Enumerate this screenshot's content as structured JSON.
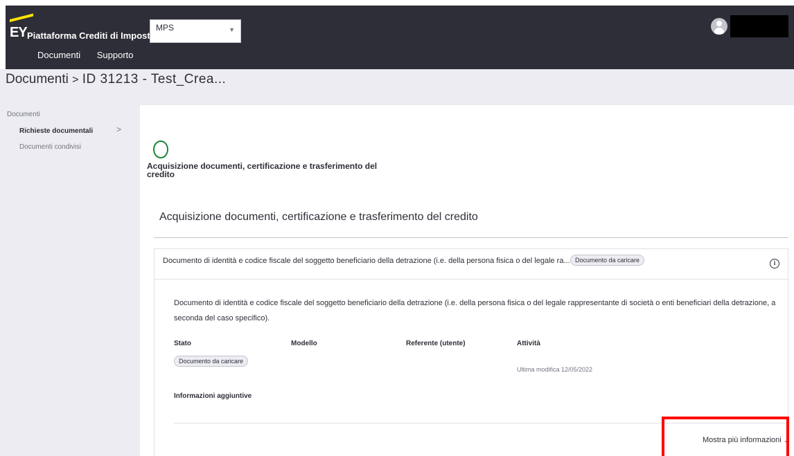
{
  "header": {
    "logo_text": "EY",
    "app_title": "Piattaforma Crediti di Imposta",
    "client_select_value": "MPS",
    "nav": [
      "Documenti",
      "Supporto"
    ]
  },
  "breadcrumb": {
    "root": "Documenti",
    "separator": ">",
    "current": "ID 31213 - Test_Crea..."
  },
  "sidebar": {
    "title": "Documenti",
    "items": [
      {
        "label": "Richieste documentali",
        "active": true
      },
      {
        "label": "Documenti condivisi",
        "active": false
      }
    ]
  },
  "step": {
    "title": "Acquisizione documenti, certificazione e trasferimento del credito"
  },
  "section": {
    "title": "Acquisizione documenti, certificazione e trasferimento del credito"
  },
  "card": {
    "header_title": "Documento di identità e codice fiscale del soggetto beneficiario della detrazione (i.e. della persona fisica o del legale ra...",
    "header_badge": "Documento da caricare",
    "description": "Documento di identità e codice fiscale del soggetto beneficiario della detrazione (i.e. della persona fisica o del legale rappresentante di società o enti beneficiari della detrazione, a seconda del caso specifico).",
    "columns": {
      "stato": "Stato",
      "modello": "Modello",
      "referente": "Referente (utente)",
      "attivita": "Attività"
    },
    "stato_badge": "Documento da caricare",
    "ultima_modifica": "Ultima modifica 12/05/2022",
    "info_aggiuntive": "Informazioni aggiuntive",
    "mostra_label": "Mostra più informazioni"
  },
  "colors": {
    "header_bg": "#2e2e38",
    "ey_yellow": "#ffe600",
    "status_green": "#168736",
    "highlight_red": "#ff0000"
  }
}
